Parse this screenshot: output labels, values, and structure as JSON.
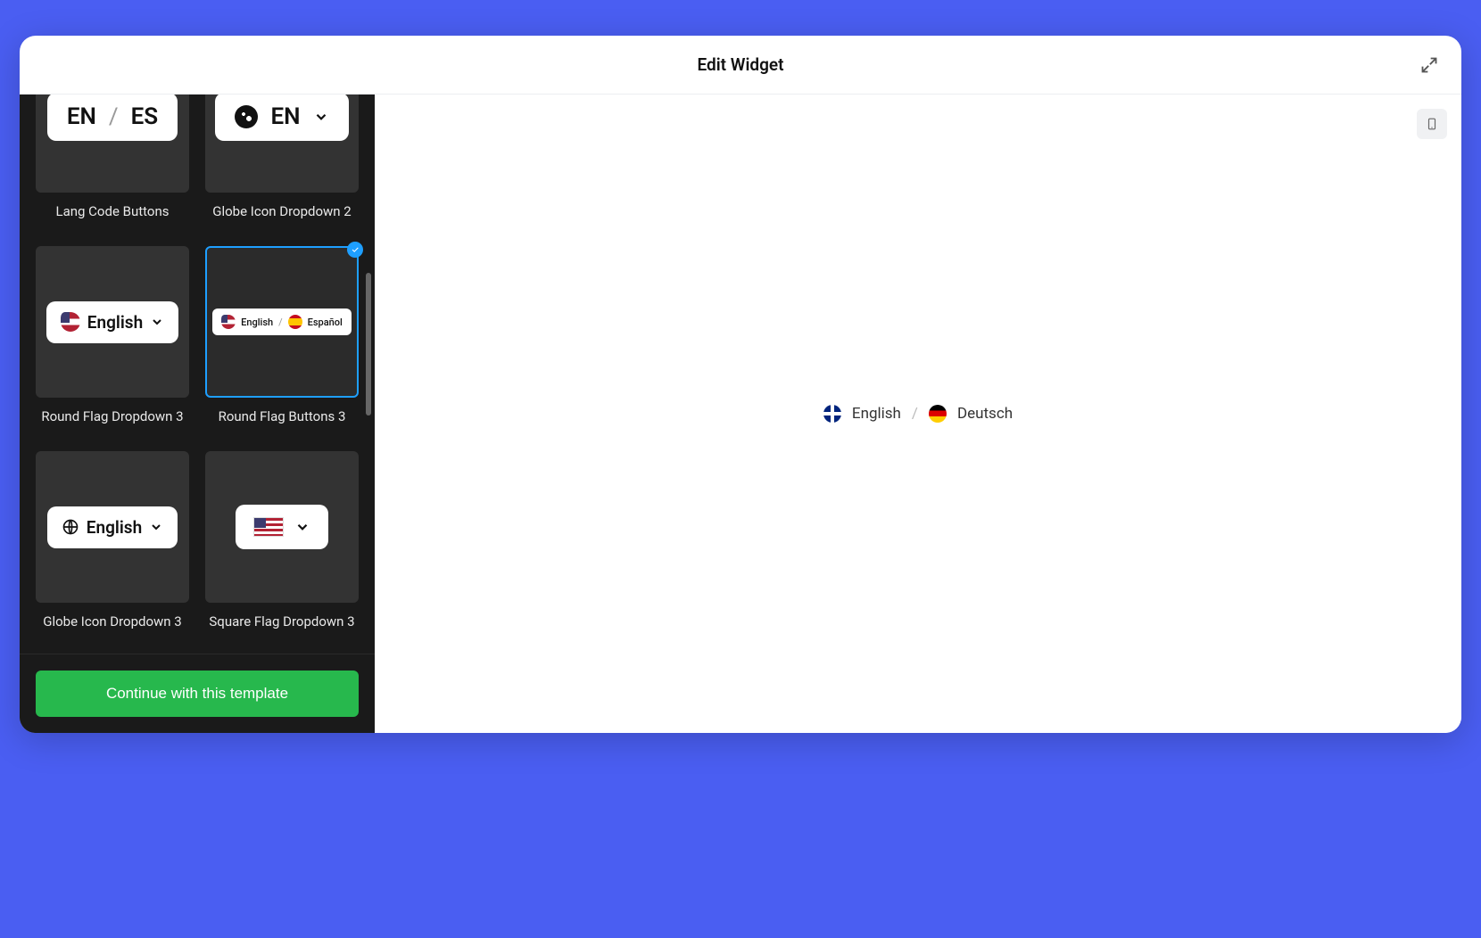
{
  "header": {
    "title": "Edit Widget"
  },
  "sidebar": {
    "templates": [
      {
        "id": "lang-code-buttons",
        "label": "Lang Code Buttons",
        "selected": false,
        "mock": {
          "left": "EN",
          "right": "ES"
        }
      },
      {
        "id": "globe-icon-dropdown-2",
        "label": "Globe Icon Dropdown 2",
        "selected": false,
        "mock": {
          "code": "EN"
        }
      },
      {
        "id": "round-flag-dropdown-3",
        "label": "Round Flag Dropdown 3",
        "selected": false,
        "mock": {
          "lang": "English"
        }
      },
      {
        "id": "round-flag-buttons-3",
        "label": "Round Flag Buttons 3",
        "selected": true,
        "mock": {
          "a": "English",
          "b": "Español"
        }
      },
      {
        "id": "globe-icon-dropdown-3",
        "label": "Globe Icon Dropdown 3",
        "selected": false,
        "mock": {
          "lang": "English"
        }
      },
      {
        "id": "square-flag-dropdown-3",
        "label": "Square Flag Dropdown 3",
        "selected": false,
        "mock": {}
      }
    ],
    "continue_label": "Continue with this template"
  },
  "preview": {
    "lang_a": "English",
    "lang_b": "Deutsch",
    "separator": "/"
  }
}
